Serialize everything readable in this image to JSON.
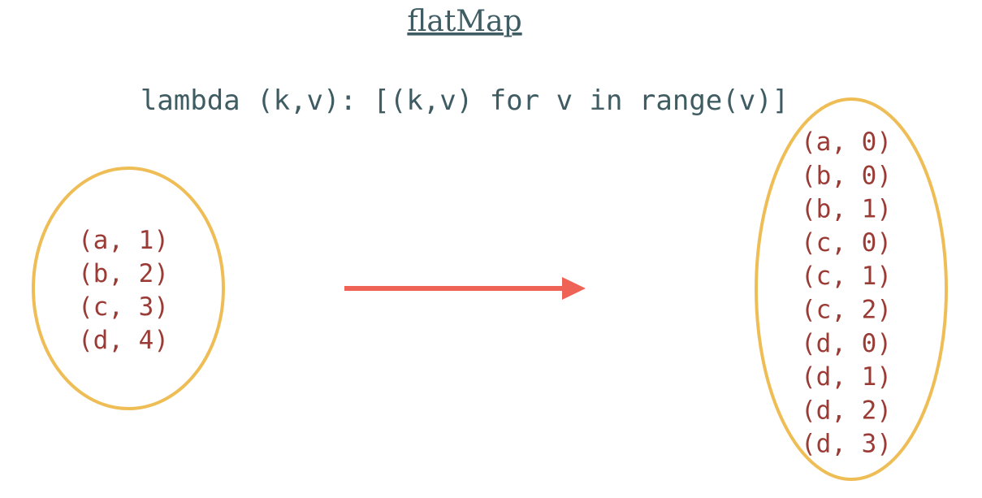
{
  "title": "flatMap",
  "function": "lambda (k,v): [(k,v) for v in range(v)]",
  "input": {
    "items": [
      "(a, 1)",
      "(b, 2)",
      "(c, 3)",
      "(d, 4)"
    ]
  },
  "output": {
    "items": [
      "(a, 0)",
      "(b, 0)",
      "(b, 1)",
      "(c, 0)",
      "(c, 1)",
      "(c, 2)",
      "(d, 0)",
      "(d, 1)",
      "(d, 2)",
      "(d, 3)"
    ]
  },
  "colors": {
    "title": "#3f5c63",
    "code": "#3f5c63",
    "item": "#9b3b36",
    "ellipse": "#efbd55",
    "arrow": "#ef6357"
  }
}
